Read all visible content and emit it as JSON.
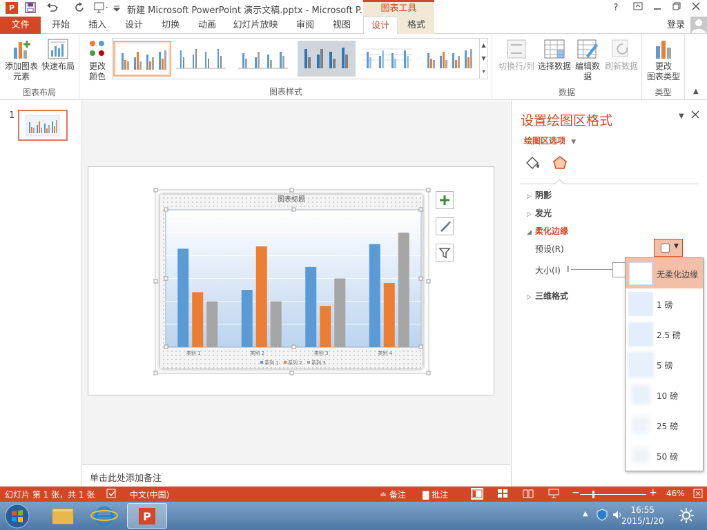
{
  "window": {
    "title": "新建 Microsoft PowerPoint 演示文稿.pptx - Microsoft P...",
    "app_logo": "P",
    "chart_tools": "图表工具",
    "help": "?",
    "login": "登录"
  },
  "tabs": {
    "file": "文件",
    "items": [
      "开始",
      "插入",
      "设计",
      "切换",
      "动画",
      "幻灯片放映",
      "审阅",
      "视图"
    ],
    "design": "设计",
    "format": "格式"
  },
  "ribbon": {
    "add_element_line1": "添加图表",
    "add_element_line2": "元素",
    "quick_layout": "快速布局",
    "layout_group": "图表布局",
    "change_color_line1": "更改",
    "change_color_line2": "颜色",
    "styles_group": "图表样式",
    "switch_rowcol": "切换行/列",
    "select_data": "选择数据",
    "edit_data_line1": "编辑数",
    "edit_data_line2": "据",
    "refresh_data": "刷新数据",
    "data_group": "数据",
    "change_type_line1": "更改",
    "change_type_line2": "图表类型",
    "type_group": "类型"
  },
  "thumbpane": {
    "slide_number": "1"
  },
  "notes": {
    "placeholder": "单击此处添加备注"
  },
  "chart_data": {
    "type": "bar",
    "title": "图表标题",
    "categories": [
      "类别 1",
      "类别 2",
      "类别 3",
      "类别 4"
    ],
    "series": [
      {
        "name": "系列 1",
        "values": [
          4.3,
          2.5,
          3.5,
          4.5
        ],
        "color": "#5b9bd5"
      },
      {
        "name": "系列 2",
        "values": [
          2.4,
          4.4,
          1.8,
          2.8
        ],
        "color": "#ed7d31"
      },
      {
        "name": "系列 3",
        "values": [
          2.0,
          2.0,
          3.0,
          5.0
        ],
        "color": "#a5a5a5"
      }
    ],
    "ylim": [
      0,
      6
    ],
    "grid": true,
    "legend": "bottom"
  },
  "format_pane": {
    "title": "设置绘图区格式",
    "options": "绘图区选项",
    "sections": {
      "shadow": "阴影",
      "glow": "发光",
      "soft_edges": "柔化边缘",
      "three_d": "三维格式"
    },
    "preset_label": "预设(R)",
    "size_label": "大小(I)",
    "size_glyph": "I"
  },
  "soft_edge_dropdown": {
    "items": [
      "无柔化边缘",
      "1 磅",
      "2.5 磅",
      "5 磅",
      "10 磅",
      "25 磅",
      "50 磅"
    ]
  },
  "status": {
    "slide_info": "幻灯片 第 1 张，共 1 张",
    "language": "中文(中国)",
    "notes": "备注",
    "comments": "批注",
    "zoom": "46%",
    "zoom_level": 0.46
  },
  "taskbar": {
    "time": "16:55",
    "date": "2015/1/20"
  },
  "colors": {
    "accent": "#d24726",
    "series1": "#5b9bd5",
    "series2": "#ed7d31",
    "series3": "#a5a5a5"
  }
}
